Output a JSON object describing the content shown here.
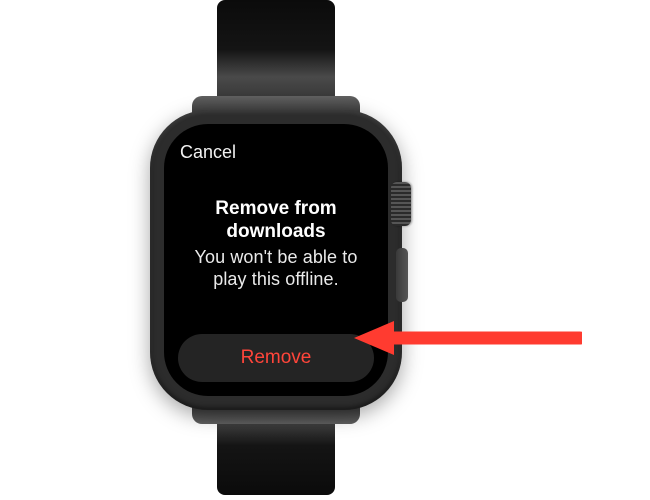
{
  "nav": {
    "cancel_label": "Cancel"
  },
  "dialog": {
    "title": "Remove from downloads",
    "message": "You won't be able to play this offline."
  },
  "action": {
    "remove_label": "Remove"
  },
  "colors": {
    "destructive": "#ff453a",
    "annotation": "#ff3b30"
  }
}
